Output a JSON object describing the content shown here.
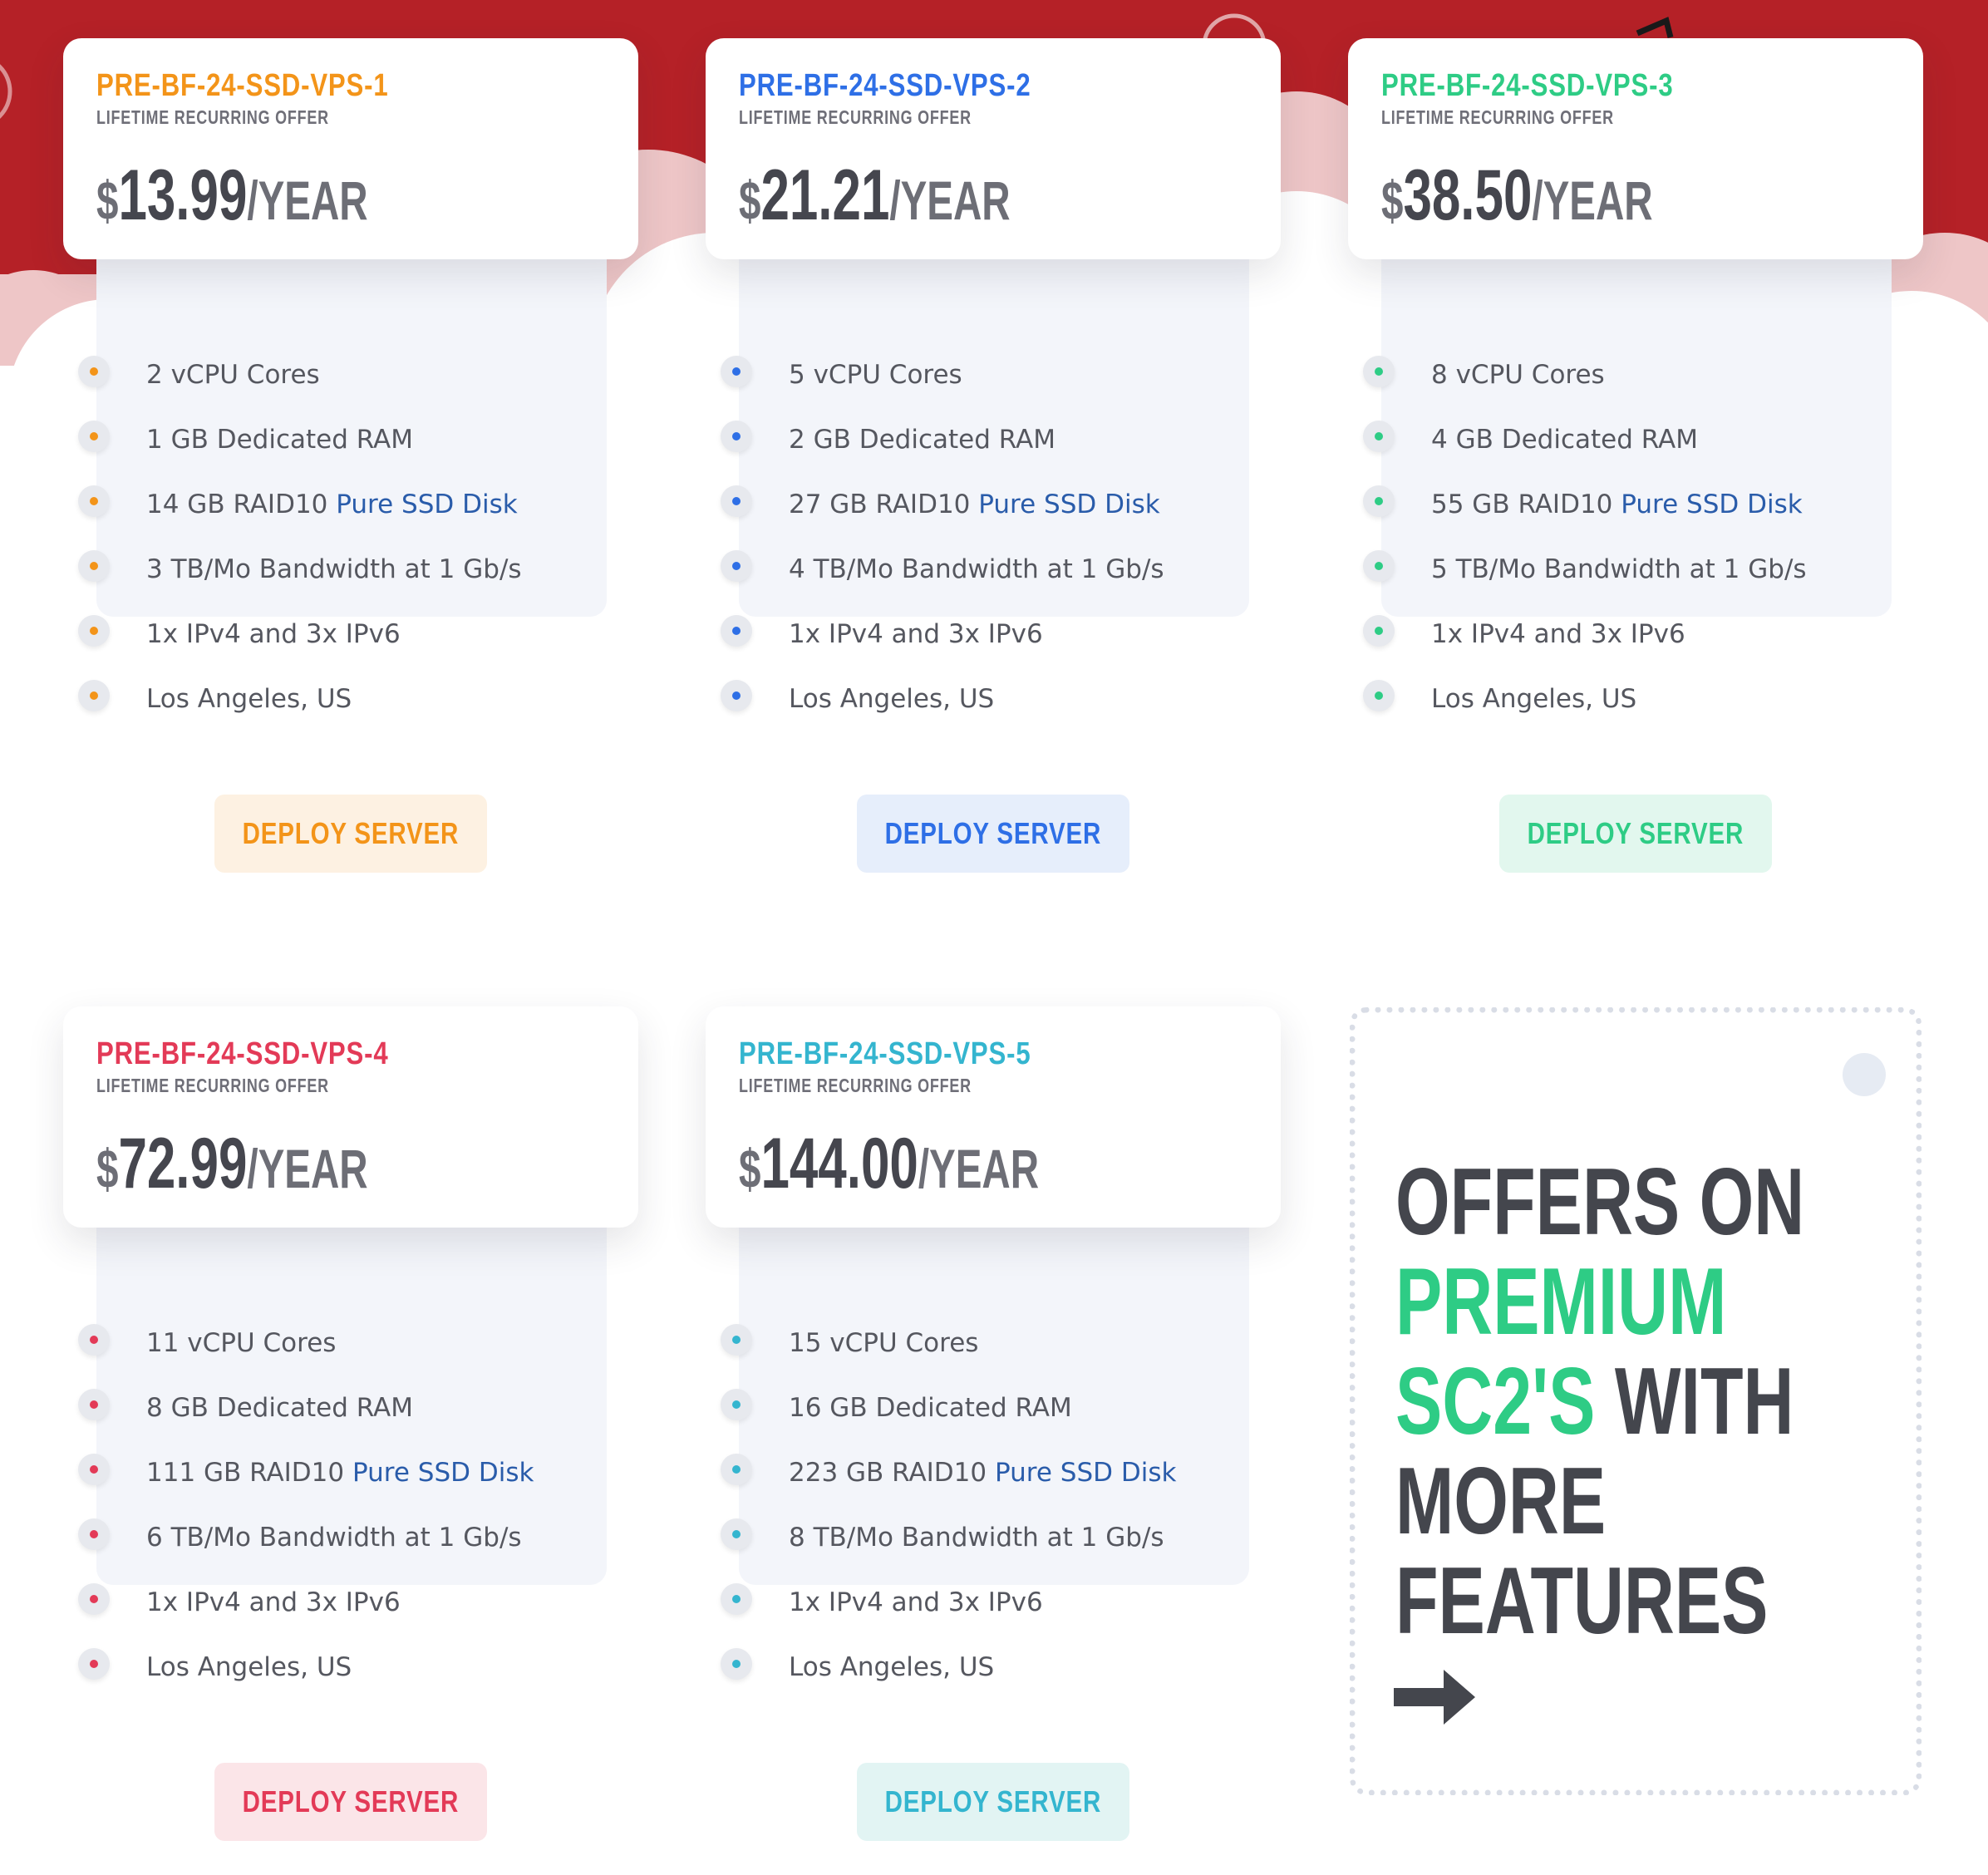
{
  "colors": {
    "banner_red": "#b52127",
    "orange": "#f39419",
    "blue": "#2e6fe6",
    "green": "#2ecc85",
    "red": "#e33a57",
    "teal": "#34b5cf",
    "link": "#2a5caa",
    "dark_text": "#44464d"
  },
  "plans": [
    {
      "name": "PRE-BF-24-SSD-VPS-1",
      "subtitle": "LIFETIME RECURRING OFFER",
      "currency": "$",
      "price": "13.99",
      "period": "/YEAR",
      "accent": "#f39419",
      "button_bg": "#fdf1e2",
      "features": {
        "cpu": "2 vCPU Cores",
        "ram": "1 GB Dedicated RAM",
        "disk_prefix": "14 GB RAID10",
        "disk_link": "Pure SSD Disk",
        "bandwidth": "3 TB/Mo Bandwidth at 1 Gb/s",
        "ips": "1x IPv4 and 3x IPv6",
        "location": "Los Angeles, US"
      },
      "button": "DEPLOY SERVER"
    },
    {
      "name": "PRE-BF-24-SSD-VPS-2",
      "subtitle": "LIFETIME RECURRING OFFER",
      "currency": "$",
      "price": "21.21",
      "period": "/YEAR",
      "accent": "#2e6fe6",
      "button_bg": "#e6eefb",
      "features": {
        "cpu": "5 vCPU Cores",
        "ram": "2 GB Dedicated RAM",
        "disk_prefix": "27 GB RAID10",
        "disk_link": "Pure SSD Disk",
        "bandwidth": "4 TB/Mo Bandwidth at 1 Gb/s",
        "ips": "1x IPv4 and 3x IPv6",
        "location": "Los Angeles, US"
      },
      "button": "DEPLOY SERVER"
    },
    {
      "name": "PRE-BF-24-SSD-VPS-3",
      "subtitle": "LIFETIME RECURRING OFFER",
      "currency": "$",
      "price": "38.50",
      "period": "/YEAR",
      "accent": "#2ecc85",
      "button_bg": "#e2f7ee",
      "features": {
        "cpu": "8 vCPU Cores",
        "ram": "4 GB Dedicated RAM",
        "disk_prefix": "55 GB RAID10",
        "disk_link": "Pure SSD Disk",
        "bandwidth": "5 TB/Mo Bandwidth at 1 Gb/s",
        "ips": "1x IPv4 and 3x IPv6",
        "location": "Los Angeles, US"
      },
      "button": "DEPLOY SERVER"
    },
    {
      "name": "PRE-BF-24-SSD-VPS-4",
      "subtitle": "LIFETIME RECURRING OFFER",
      "currency": "$",
      "price": "72.99",
      "period": "/YEAR",
      "accent": "#e33a57",
      "button_bg": "#fbe5e8",
      "features": {
        "cpu": "11 vCPU Cores",
        "ram": "8 GB Dedicated RAM",
        "disk_prefix": "111 GB RAID10",
        "disk_link": "Pure SSD Disk",
        "bandwidth": "6 TB/Mo Bandwidth at 1 Gb/s",
        "ips": "1x IPv4 and 3x IPv6",
        "location": "Los Angeles, US"
      },
      "button": "DEPLOY SERVER"
    },
    {
      "name": "PRE-BF-24-SSD-VPS-5",
      "subtitle": "LIFETIME RECURRING OFFER",
      "currency": "$",
      "price": "144.00",
      "period": "/YEAR",
      "accent": "#34b5cf",
      "button_bg": "#e2f4f3",
      "features": {
        "cpu": "15 vCPU Cores",
        "ram": "16 GB Dedicated RAM",
        "disk_prefix": "223 GB RAID10",
        "disk_link": "Pure SSD Disk",
        "bandwidth": "8 TB/Mo Bandwidth at 1 Gb/s",
        "ips": "1x IPv4 and 3x IPv6",
        "location": "Los Angeles, US"
      },
      "button": "DEPLOY SERVER"
    }
  ],
  "promo": {
    "line1": "OFFERS ON",
    "line2_green": "PREMIUM",
    "line3_green": "SC2'S",
    "line3_rest": "WITH",
    "line4": "MORE",
    "line5": "FEATURES",
    "arrow_icon": "arrow-right-icon"
  }
}
